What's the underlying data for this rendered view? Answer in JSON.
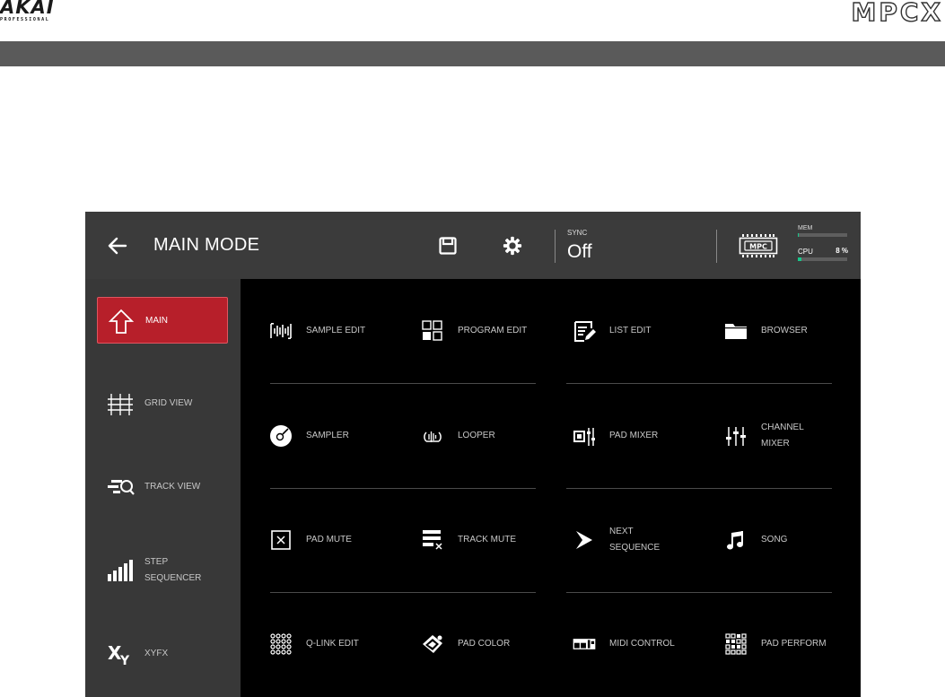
{
  "brand": {
    "akai": "AKAI",
    "akai_sub": "PROFESSIONAL",
    "model": "MPCX"
  },
  "header": {
    "title": "MAIN MODE",
    "sync_label": "SYNC",
    "sync_value": "Off",
    "mem_label": "MEM",
    "mem_fraction": 0.02,
    "cpu_label": "CPU",
    "cpu_value": "8 %",
    "cpu_fraction": 0.08,
    "accent_color": "#18c58a"
  },
  "sidebar": {
    "active_color": "#b71f2a",
    "items": [
      {
        "label": "MAIN",
        "icon": "home-arrow-icon",
        "active": true
      },
      {
        "label": "GRID VIEW",
        "icon": "grid-view-icon"
      },
      {
        "label": "TRACK VIEW",
        "icon": "track-view-icon"
      },
      {
        "label": "STEP\nSEQUENCER",
        "icon": "step-sequencer-icon"
      },
      {
        "label": "XYFX",
        "icon": "xyfx-icon"
      }
    ]
  },
  "modes": [
    {
      "label": "SAMPLE EDIT",
      "icon": "waveform-icon"
    },
    {
      "label": "PROGRAM EDIT",
      "icon": "program-grid-icon"
    },
    {
      "label": "LIST EDIT",
      "icon": "list-edit-icon"
    },
    {
      "label": "BROWSER",
      "icon": "folder-icon"
    },
    {
      "label": "SAMPLER",
      "icon": "sampler-disc-icon"
    },
    {
      "label": "LOOPER",
      "icon": "looper-icon"
    },
    {
      "label": "PAD MIXER",
      "icon": "pad-mixer-icon"
    },
    {
      "label": "CHANNEL\nMIXER",
      "icon": "channel-mixer-icon"
    },
    {
      "label": "PAD MUTE",
      "icon": "pad-mute-icon"
    },
    {
      "label": "TRACK MUTE",
      "icon": "track-mute-icon"
    },
    {
      "label": "NEXT\nSEQUENCE",
      "icon": "next-sequence-icon"
    },
    {
      "label": "SONG",
      "icon": "music-note-icon"
    },
    {
      "label": "Q-LINK EDIT",
      "icon": "qlink-dots-icon"
    },
    {
      "label": "PAD COLOR",
      "icon": "pad-color-icon"
    },
    {
      "label": "MIDI CONTROL",
      "icon": "midi-control-icon"
    },
    {
      "label": "PAD PERFORM",
      "icon": "pad-perform-icon"
    }
  ]
}
